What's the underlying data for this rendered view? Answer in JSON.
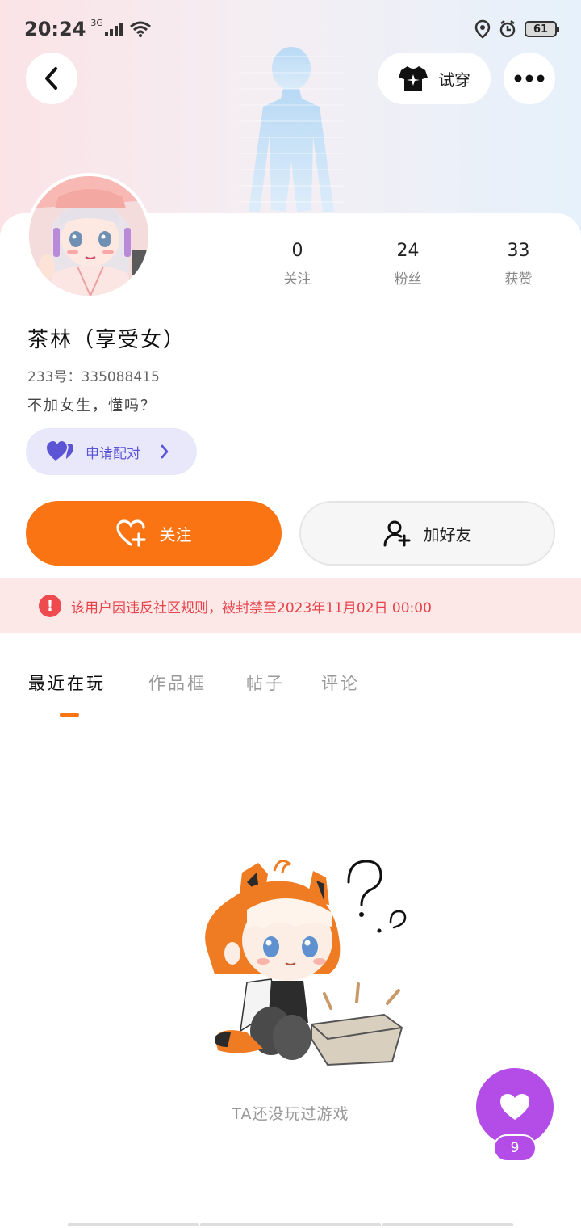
{
  "status_bar": {
    "time": "20:24",
    "network": "3G",
    "battery": "61"
  },
  "header": {
    "try_on_label": "试穿"
  },
  "profile": {
    "stats": [
      {
        "value": "0",
        "label": "关注"
      },
      {
        "value": "24",
        "label": "粉丝"
      },
      {
        "value": "33",
        "label": "获赞"
      }
    ],
    "nickname": "茶林（享受女）",
    "uid": "233号：335088415",
    "bio": "不加女生，懂吗？",
    "pair_label": "申请配对"
  },
  "actions": {
    "follow_label": "关注",
    "add_friend_label": "加好友"
  },
  "ban_notice": {
    "text": "该用户因违反社区规则，被封禁至2023年11月02日 00:00"
  },
  "tabs": [
    {
      "label": "最近在玩",
      "active": true
    },
    {
      "label": "作品框",
      "active": false
    },
    {
      "label": "帖子",
      "active": false
    },
    {
      "label": "评论",
      "active": false
    }
  ],
  "empty_state": {
    "text": "TA还没玩过游戏"
  },
  "like_fab": {
    "count": "9"
  },
  "colors": {
    "accent_orange": "#fa7414",
    "pair_purple": "#5b55d6",
    "like_purple": "#b44de8",
    "ban_red": "#e8434a"
  }
}
